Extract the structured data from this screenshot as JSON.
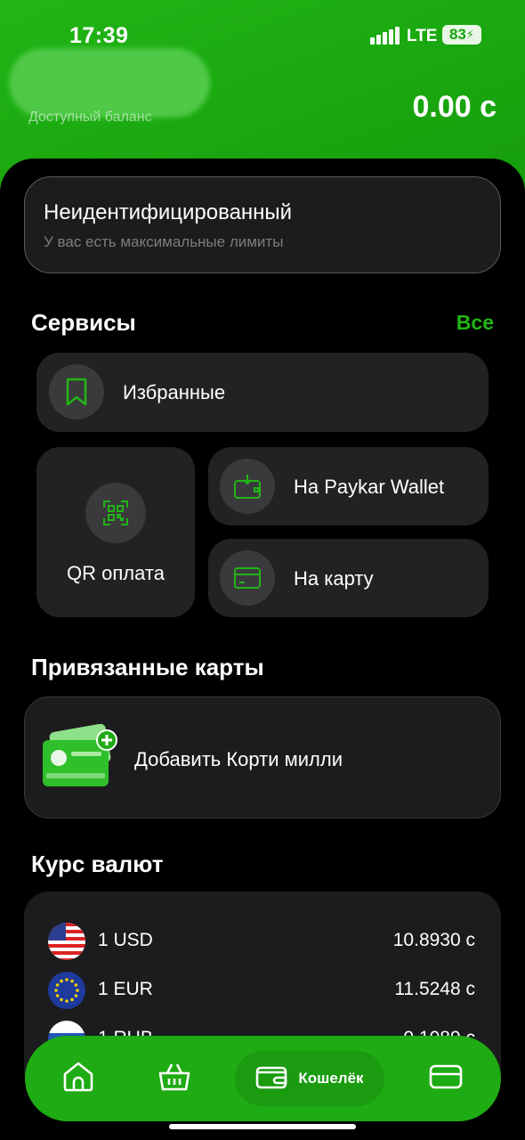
{
  "status_bar": {
    "time": "17:39",
    "network": "LTE",
    "battery": "83"
  },
  "header": {
    "balance_label": "Доступный баланс",
    "balance_value": "0.00 с"
  },
  "identification": {
    "title": "Неидентифицированный",
    "subtitle": "У вас есть максимальные лимиты"
  },
  "services": {
    "title": "Сервисы",
    "all_link": "Все",
    "favorites": "Избранные",
    "qr_payment": "QR оплата",
    "to_wallet": "На Paykar Wallet",
    "to_card": "На карту"
  },
  "linked_cards": {
    "title": "Привязанные карты",
    "add_label": "Добавить Корти милли"
  },
  "rates": {
    "title": "Курс валют",
    "items": [
      {
        "currency": "1 USD",
        "value": "10.8930 с",
        "flag": "us-flag-icon"
      },
      {
        "currency": "1 EUR",
        "value": "11.5248 с",
        "flag": "eu-flag-icon"
      },
      {
        "currency": "1 RUB",
        "value": "0.1089 с",
        "flag": "ru-flag-icon"
      }
    ]
  },
  "bottom_nav": {
    "items": [
      {
        "icon": "home-icon"
      },
      {
        "icon": "basket-icon"
      },
      {
        "icon": "wallet-icon",
        "label": "Кошелёк",
        "active": true
      },
      {
        "icon": "card-icon"
      }
    ]
  },
  "colors": {
    "brand_green": "#21b516",
    "surface": "#1c1c1e",
    "tile": "#222224"
  }
}
